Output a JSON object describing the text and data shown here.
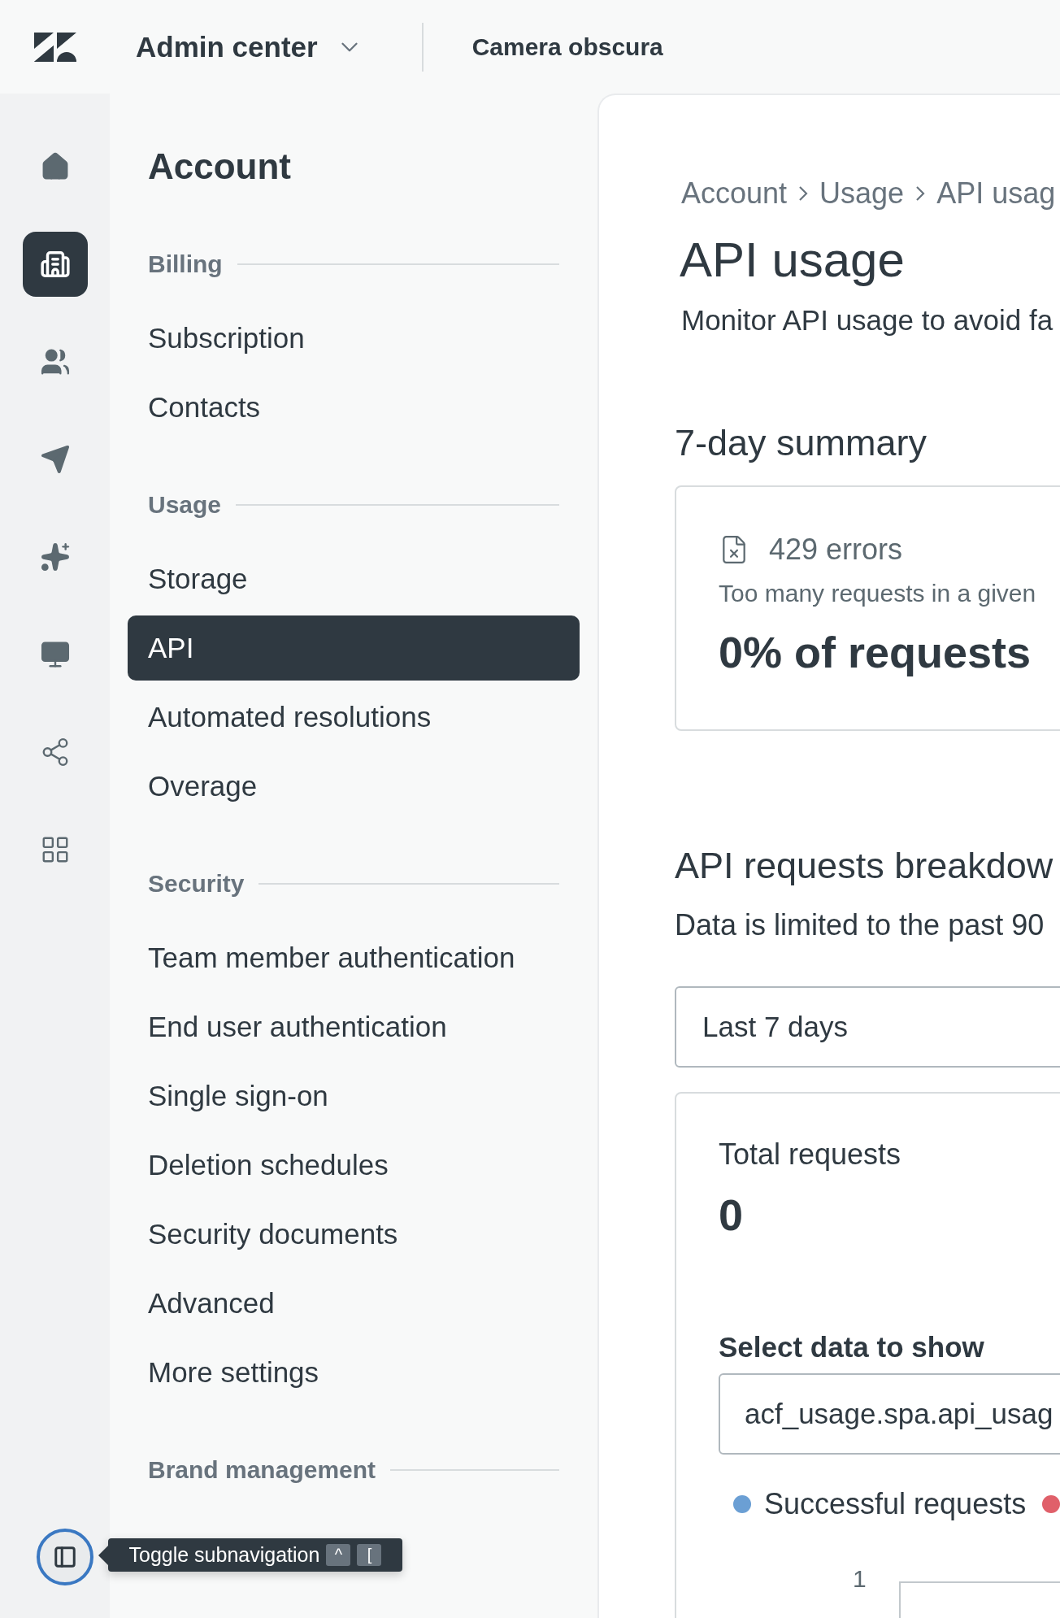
{
  "top_bar": {
    "product": "Admin center",
    "account": "Camera obscura"
  },
  "rail": {
    "items": [
      {
        "kind": "home",
        "selected": false
      },
      {
        "kind": "building",
        "selected": true
      },
      {
        "kind": "people",
        "selected": false
      },
      {
        "kind": "send",
        "selected": false
      },
      {
        "kind": "sparkle",
        "selected": false
      },
      {
        "kind": "monitor",
        "selected": false
      },
      {
        "kind": "share",
        "selected": false
      },
      {
        "kind": "apps",
        "selected": false
      }
    ],
    "toggle_tooltip": {
      "text": "Toggle subnavigation",
      "keys": [
        "^",
        "["
      ]
    }
  },
  "subnav": {
    "title": "Account",
    "sections": [
      {
        "label": "Billing",
        "items": [
          {
            "label": "Subscription",
            "selected": false
          },
          {
            "label": "Contacts",
            "selected": false
          }
        ]
      },
      {
        "label": "Usage",
        "items": [
          {
            "label": "Storage",
            "selected": false
          },
          {
            "label": "API",
            "selected": true
          },
          {
            "label": "Automated resolutions",
            "selected": false
          },
          {
            "label": "Overage",
            "selected": false
          }
        ]
      },
      {
        "label": "Security",
        "items": [
          {
            "label": "Team member authentication",
            "selected": false
          },
          {
            "label": "End user authentication",
            "selected": false
          },
          {
            "label": "Single sign-on",
            "selected": false
          },
          {
            "label": "Deletion schedules",
            "selected": false
          },
          {
            "label": "Security documents",
            "selected": false
          },
          {
            "label": "Advanced",
            "selected": false
          },
          {
            "label": "More settings",
            "selected": false
          }
        ]
      },
      {
        "label": "Brand management"
      }
    ]
  },
  "main": {
    "breadcrumb": [
      "Account",
      "Usage",
      "API usag"
    ],
    "title": "API usage",
    "description": "Monitor API usage to avoid fa",
    "summary": {
      "heading": "7-day summary",
      "card": {
        "label": "429 errors",
        "note": "Too many requests in a given",
        "value": "0% of requests"
      }
    },
    "breakdown": {
      "heading": "API requests breakdow",
      "note": "Data is limited to the past 90",
      "period": "Last 7 days",
      "total_label": "Total requests",
      "total_value": "0",
      "select_label": "Select data to show",
      "select_value": "acf_usage.spa.api_usag",
      "legend": [
        {
          "label": "Successful requests",
          "color": "#6b9fd4"
        },
        {
          "color": "#e0606a"
        }
      ],
      "chart": {
        "y_tick": "1"
      }
    }
  }
}
